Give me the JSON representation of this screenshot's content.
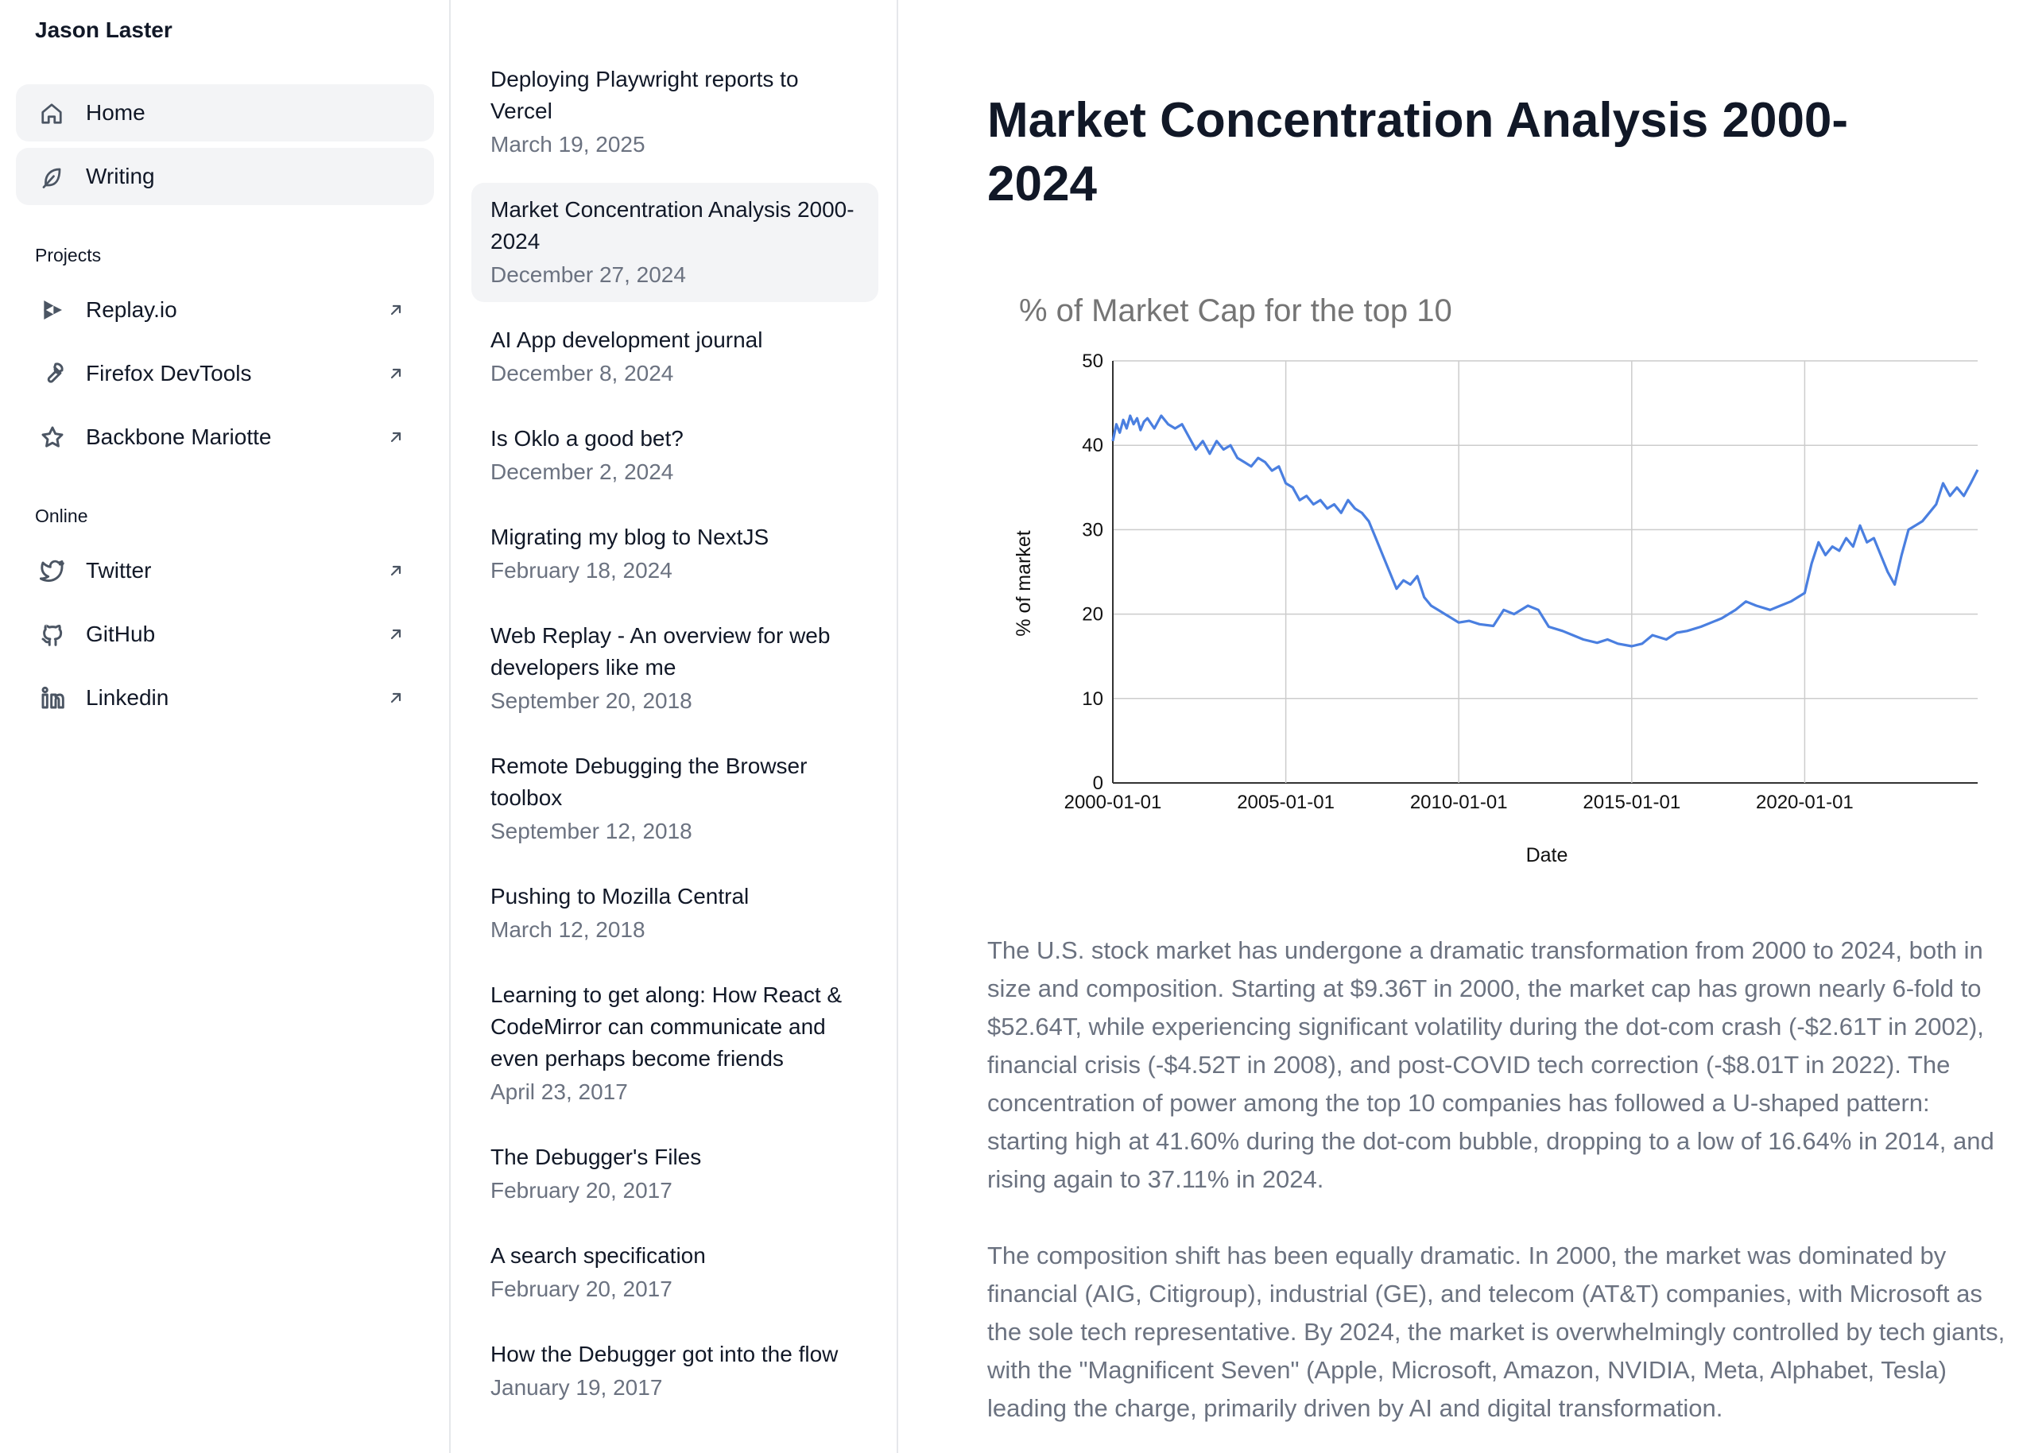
{
  "sidebar": {
    "owner": "Jason Laster",
    "nav": [
      {
        "label": "Home",
        "icon": "home-icon"
      },
      {
        "label": "Writing",
        "icon": "feather-icon"
      }
    ],
    "projects_heading": "Projects",
    "projects": [
      {
        "label": "Replay.io",
        "icon": "replay-icon"
      },
      {
        "label": "Firefox DevTools",
        "icon": "wrench-icon"
      },
      {
        "label": "Backbone Mariotte",
        "icon": "star-icon"
      }
    ],
    "online_heading": "Online",
    "online": [
      {
        "label": "Twitter",
        "icon": "twitter-icon"
      },
      {
        "label": "GitHub",
        "icon": "github-icon"
      },
      {
        "label": "Linkedin",
        "icon": "linkedin-icon"
      }
    ]
  },
  "posts": [
    {
      "title": "Deploying Playwright reports to Vercel",
      "date": "March 19, 2025"
    },
    {
      "title": "Market Concentration Analysis 2000-2024",
      "date": "December 27, 2024"
    },
    {
      "title": "AI App development journal",
      "date": "December 8, 2024"
    },
    {
      "title": "Is Oklo a good bet?",
      "date": "December 2, 2024"
    },
    {
      "title": "Migrating my blog to NextJS",
      "date": "February 18, 2024"
    },
    {
      "title": "Web Replay - An overview for web developers like me",
      "date": "September 20, 2018"
    },
    {
      "title": "Remote Debugging the Browser toolbox",
      "date": "September 12, 2018"
    },
    {
      "title": "Pushing to Mozilla Central",
      "date": "March 12, 2018"
    },
    {
      "title": "Learning to get along: How React & CodeMirror can communicate and even perhaps become friends",
      "date": "April 23, 2017"
    },
    {
      "title": "The Debugger's Files",
      "date": "February 20, 2017"
    },
    {
      "title": "A search specification",
      "date": "February 20, 2017"
    },
    {
      "title": "How the Debugger got into the flow",
      "date": "January 19, 2017"
    }
  ],
  "article": {
    "title": "Market Concentration Analysis 2000-2024",
    "paragraphs": [
      "The U.S. stock market has undergone a dramatic transformation from 2000 to 2024, both in size and composition. Starting at $9.36T in 2000, the market cap has grown nearly 6-fold to $52.64T, while experiencing significant volatility during the dot-com crash (-$2.61T in 2002), financial crisis (-$4.52T in 2008), and post-COVID tech correction (-$8.01T in 2022). The concentration of power among the top 10 companies has followed a U-shaped pattern: starting high at 41.60% during the dot-com bubble, dropping to a low of 16.64% in 2014, and rising again to 37.11% in 2024.",
      "The composition shift has been equally dramatic. In 2000, the market was dominated by financial (AIG, Citigroup), industrial (GE), and telecom (AT&T) companies, with Microsoft as the sole tech representative. By 2024, the market is overwhelmingly controlled by tech giants, with the \"Magnificent Seven\" (Apple, Microsoft, Amazon, NVIDIA, Meta, Alphabet, Tesla) leading the charge, primarily driven by AI and digital transformation."
    ]
  },
  "chart_data": {
    "type": "line",
    "title": "% of Market Cap for the top 10",
    "xlabel": "Date",
    "ylabel": "% of market",
    "x_ticks": [
      "2000-01-01",
      "2005-01-01",
      "2010-01-01",
      "2015-01-01",
      "2020-01-01"
    ],
    "y_ticks": [
      0,
      10,
      20,
      30,
      40,
      50
    ],
    "xlim": [
      2000.0,
      2025.0
    ],
    "ylim": [
      0,
      50
    ],
    "grid": true,
    "line_color": "#4a7fe0",
    "series": [
      {
        "x": [
          2000.0,
          2000.1,
          2000.2,
          2000.3,
          2000.4,
          2000.5,
          2000.6,
          2000.7,
          2000.8,
          2000.9,
          2001.0,
          2001.2,
          2001.4,
          2001.6,
          2001.8,
          2002.0,
          2002.2,
          2002.4,
          2002.6,
          2002.8,
          2003.0,
          2003.2,
          2003.4,
          2003.6,
          2003.8,
          2004.0,
          2004.2,
          2004.4,
          2004.6,
          2004.8,
          2005.0,
          2005.2,
          2005.4,
          2005.6,
          2005.8,
          2006.0,
          2006.2,
          2006.4,
          2006.6,
          2006.8,
          2007.0,
          2007.2,
          2007.4,
          2007.6,
          2007.8,
          2008.0,
          2008.2,
          2008.4,
          2008.6,
          2008.8,
          2009.0,
          2009.2,
          2009.4,
          2009.6,
          2009.8,
          2010.0,
          2010.3,
          2010.6,
          2011.0,
          2011.3,
          2011.6,
          2012.0,
          2012.3,
          2012.6,
          2013.0,
          2013.3,
          2013.6,
          2014.0,
          2014.3,
          2014.6,
          2015.0,
          2015.3,
          2015.6,
          2016.0,
          2016.3,
          2016.6,
          2017.0,
          2017.3,
          2017.6,
          2018.0,
          2018.3,
          2018.6,
          2019.0,
          2019.3,
          2019.6,
          2020.0,
          2020.2,
          2020.4,
          2020.6,
          2020.8,
          2021.0,
          2021.2,
          2021.4,
          2021.6,
          2021.8,
          2022.0,
          2022.2,
          2022.4,
          2022.6,
          2022.8,
          2023.0,
          2023.2,
          2023.4,
          2023.6,
          2023.8,
          2024.0,
          2024.2,
          2024.4,
          2024.6,
          2024.8,
          2025.0
        ],
        "y": [
          40.5,
          42.5,
          41.5,
          43.0,
          42.0,
          43.5,
          42.5,
          43.2,
          41.8,
          42.8,
          43.2,
          42.0,
          43.5,
          42.5,
          42.0,
          42.5,
          41.0,
          39.5,
          40.5,
          39.0,
          40.5,
          39.5,
          40.0,
          38.5,
          38.0,
          37.5,
          38.5,
          38.0,
          37.0,
          37.5,
          35.5,
          35.0,
          33.5,
          34.0,
          33.0,
          33.5,
          32.5,
          33.0,
          32.0,
          33.5,
          32.5,
          32.0,
          31.0,
          29.0,
          27.0,
          25.0,
          23.0,
          24.0,
          23.5,
          24.5,
          22.0,
          21.0,
          20.5,
          20.0,
          19.5,
          19.0,
          19.2,
          18.8,
          18.6,
          20.5,
          20.0,
          21.0,
          20.5,
          18.5,
          18.0,
          17.5,
          17.0,
          16.6,
          17.0,
          16.5,
          16.2,
          16.5,
          17.5,
          17.0,
          17.8,
          18.0,
          18.5,
          19.0,
          19.5,
          20.5,
          21.5,
          21.0,
          20.5,
          21.0,
          21.5,
          22.5,
          26.0,
          28.5,
          27.0,
          28.0,
          27.5,
          29.0,
          28.0,
          30.5,
          28.5,
          29.0,
          27.0,
          25.0,
          23.5,
          27.0,
          30.0,
          30.5,
          31.0,
          32.0,
          33.0,
          35.5,
          34.0,
          35.0,
          34.0,
          35.5,
          37.1
        ]
      }
    ]
  }
}
